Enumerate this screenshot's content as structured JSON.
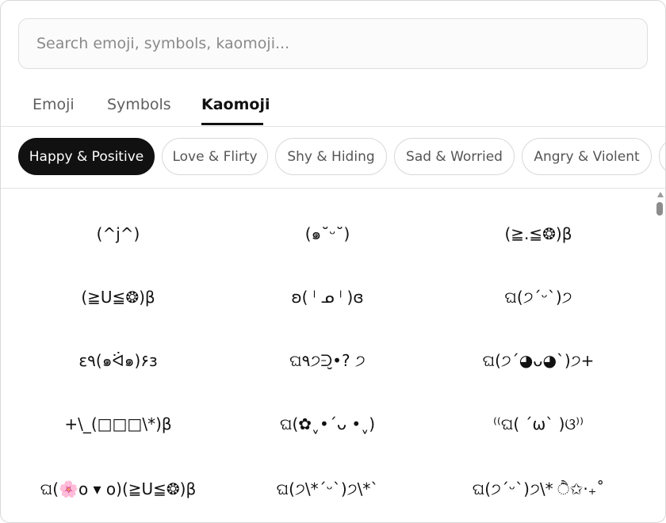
{
  "search": {
    "placeholder": "Search emoji, symbols, kaomoji..."
  },
  "tabs": [
    {
      "label": "Emoji"
    },
    {
      "label": "Symbols"
    },
    {
      "label": "Kaomoji",
      "active": true
    }
  ],
  "categories": [
    {
      "label": "Happy & Positive",
      "active": true
    },
    {
      "label": "Love & Flirty"
    },
    {
      "label": "Shy & Hiding"
    },
    {
      "label": "Sad & Worried"
    },
    {
      "label": "Angry & Violent"
    }
  ],
  "kaomoji": [
    [
      "(^j^)",
      "(๑˘ᵕ˘)",
      "(≧.≦❂)β"
    ],
    [
      "(≧U≦❂)β",
      "ʚ( ˡ ᓄ ˡ )ɞ",
      "ଘ(੭´ᵕ`)੭"
    ],
    [
      "ε٩(๑ᐛ๑)۶ɜ",
      "ଘ۹੭ᕭ̮•? ੭",
      "ଘ(੭ˊ◕ᴗ◕ˋ)੭+"
    ],
    [
      "+\\_(□□□\\*)β",
      "ଘ(✿ˬ•´ᴗ •ˬ)",
      "⁽⁽ଘ( ˊωˋ )ଓ⁾⁾"
    ],
    [
      "ଘ(🌸ο ▾ ο)(≧U≦❂)β",
      "ଘ(੭\\*ˊᵕˋ)੭\\*`",
      "ଘ(੭ˊᵕˋ)੭\\* ੈ✩‧₊˚"
    ]
  ],
  "colors": {
    "accent": "#111111",
    "border": "#d8d8d8",
    "muted_text": "#5f5f5f"
  }
}
